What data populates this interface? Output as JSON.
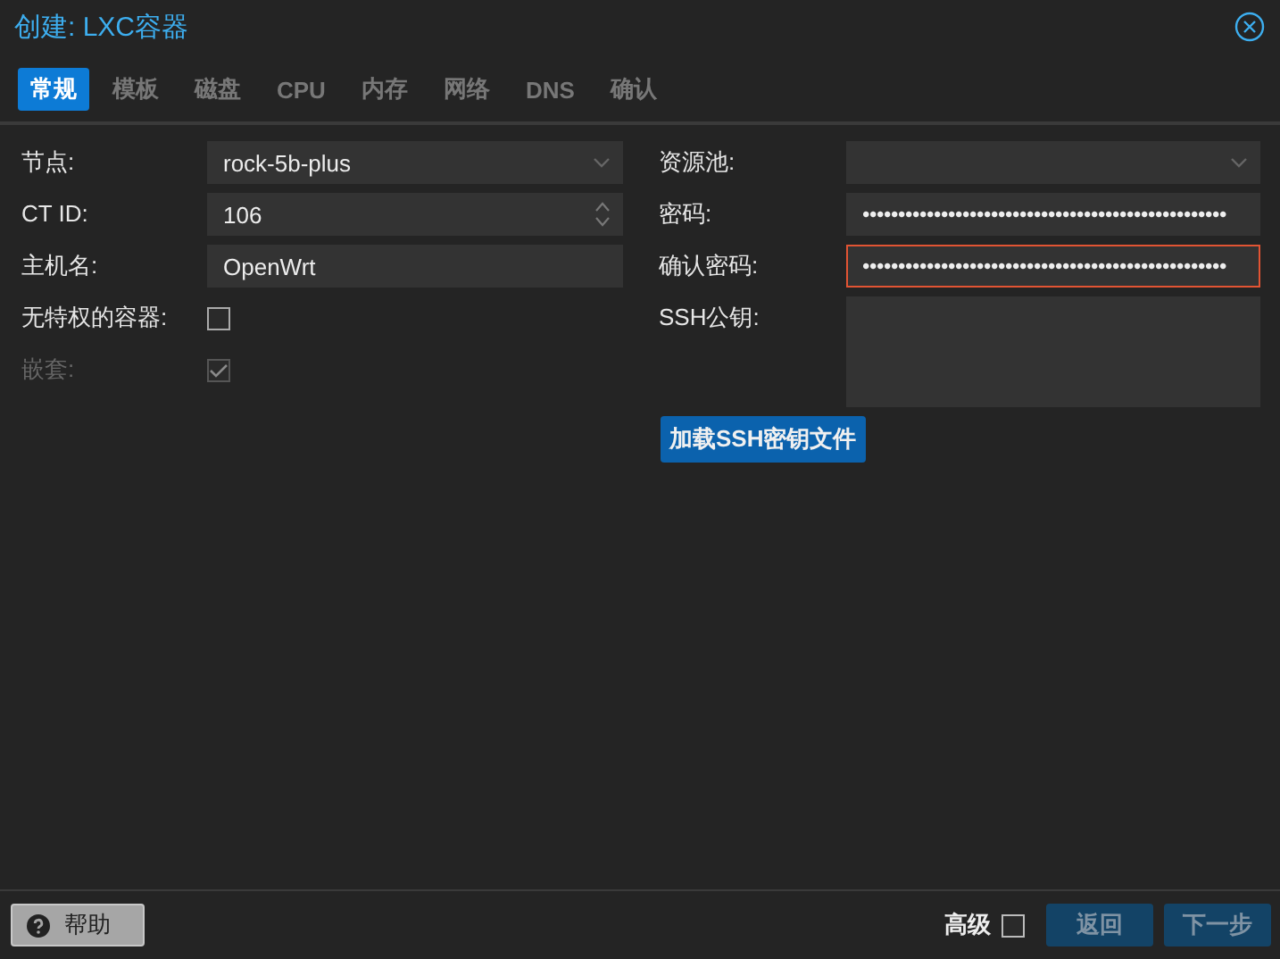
{
  "window": {
    "title": "创建: LXC容器"
  },
  "tabs": [
    {
      "label": "常规",
      "selected": true
    },
    {
      "label": "模板",
      "selected": false
    },
    {
      "label": "磁盘",
      "selected": false
    },
    {
      "label": "CPU",
      "selected": false
    },
    {
      "label": "内存",
      "selected": false
    },
    {
      "label": "网络",
      "selected": false
    },
    {
      "label": "DNS",
      "selected": false
    },
    {
      "label": "确认",
      "selected": false
    }
  ],
  "left_fields": [
    {
      "kind": "combo",
      "label": "节点:",
      "value": "rock-5b-plus",
      "disabled": false
    },
    {
      "kind": "spinner",
      "label": "CT ID:",
      "value": "106",
      "disabled": false
    },
    {
      "kind": "text",
      "label": "主机名:",
      "value": "OpenWrt",
      "disabled": false
    },
    {
      "kind": "checkbox",
      "label": "无特权的容器:",
      "checked": false,
      "disabled": false
    },
    {
      "kind": "checkbox",
      "label": "嵌套:",
      "checked": true,
      "disabled": true
    }
  ],
  "right_fields": [
    {
      "kind": "combo",
      "label": "资源池:",
      "invalid": false
    },
    {
      "kind": "password",
      "label": "密码:",
      "value": "•••••••••••••••••••••••••••••••••••••••••••••••••••",
      "invalid": false
    },
    {
      "kind": "password",
      "label": "确认密码:",
      "value": "•••••••••••••••••••••••••••••••••••••••••••••••••••",
      "invalid": true
    },
    {
      "kind": "textarea",
      "label": "SSH公钥:",
      "invalid": false
    }
  ],
  "load_key_button": "加载SSH密钥文件",
  "footer": {
    "help": "帮助",
    "advanced": {
      "label": "高级",
      "checked": false
    },
    "back": {
      "label": "返回",
      "disabled": true
    },
    "next": {
      "label": "下一步",
      "disabled": true
    }
  }
}
